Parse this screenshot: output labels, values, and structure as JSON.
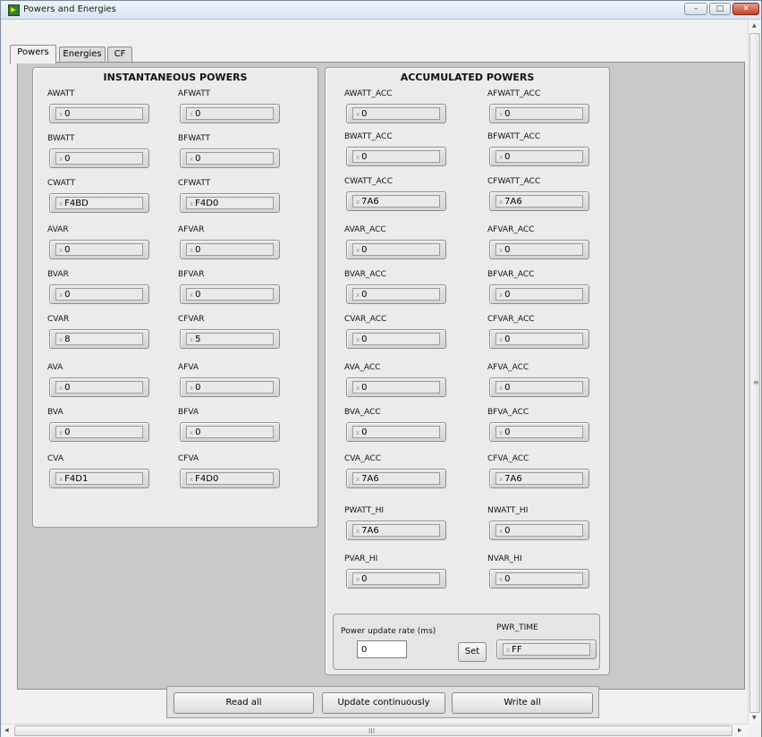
{
  "window": {
    "title": "Powers and Energies",
    "minimize": "–",
    "maximize": "□",
    "close": "✕"
  },
  "tabs": [
    {
      "label": "Powers",
      "active": true
    },
    {
      "label": "Energies",
      "active": false
    },
    {
      "label": "CF",
      "active": false
    }
  ],
  "inst": {
    "title": "INSTANTANEOUS POWERS",
    "fields": [
      {
        "label": "AWATT",
        "value": "0"
      },
      {
        "label": "AFWATT",
        "value": "0"
      },
      {
        "label": "BWATT",
        "value": "0"
      },
      {
        "label": "BFWATT",
        "value": "0"
      },
      {
        "label": "CWATT",
        "value": "F4BD"
      },
      {
        "label": "CFWATT",
        "value": "F4D0"
      },
      {
        "label": "AVAR",
        "value": "0"
      },
      {
        "label": "AFVAR",
        "value": "0"
      },
      {
        "label": "BVAR",
        "value": "0"
      },
      {
        "label": "BFVAR",
        "value": "0"
      },
      {
        "label": "CVAR",
        "value": "8"
      },
      {
        "label": "CFVAR",
        "value": "5"
      },
      {
        "label": "AVA",
        "value": "0"
      },
      {
        "label": "AFVA",
        "value": "0"
      },
      {
        "label": "BVA",
        "value": "0"
      },
      {
        "label": "BFVA",
        "value": "0"
      },
      {
        "label": "CVA",
        "value": "F4D1"
      },
      {
        "label": "CFVA",
        "value": "F4D0"
      }
    ]
  },
  "acc": {
    "title": "ACCUMULATED POWERS",
    "fields": [
      {
        "label": "AWATT_ACC",
        "value": "0"
      },
      {
        "label": "AFWATT_ACC",
        "value": "0"
      },
      {
        "label": "BWATT_ACC",
        "value": "0"
      },
      {
        "label": "BFWATT_ACC",
        "value": "0"
      },
      {
        "label": "CWATT_ACC",
        "value": "7A6"
      },
      {
        "label": "CFWATT_ACC",
        "value": "7A6"
      },
      {
        "label": "AVAR_ACC",
        "value": "0"
      },
      {
        "label": "AFVAR_ACC",
        "value": "0"
      },
      {
        "label": "BVAR_ACC",
        "value": "0"
      },
      {
        "label": "BFVAR_ACC",
        "value": "0"
      },
      {
        "label": "CVAR_ACC",
        "value": "0"
      },
      {
        "label": "CFVAR_ACC",
        "value": "0"
      },
      {
        "label": "AVA_ACC",
        "value": "0"
      },
      {
        "label": "AFVA_ACC",
        "value": "0"
      },
      {
        "label": "BVA_ACC",
        "value": "0"
      },
      {
        "label": "BFVA_ACC",
        "value": "0"
      },
      {
        "label": "CVA_ACC",
        "value": "7A6"
      },
      {
        "label": "CFVA_ACC",
        "value": "7A6"
      },
      {
        "label": "PWATT_HI",
        "value": "7A6"
      },
      {
        "label": "NWATT_HI",
        "value": "0"
      },
      {
        "label": "PVAR_HI",
        "value": "0"
      },
      {
        "label": "NVAR_HI",
        "value": "0"
      }
    ]
  },
  "rate": {
    "label": "Power update rate (ms)",
    "value": "0",
    "set_label": "Set",
    "pwr_time_label": "PWR_TIME",
    "pwr_time_value": "FF"
  },
  "hex_marker": "x",
  "buttons": {
    "read_all": "Read all",
    "update_continuously": "Update continuously",
    "write_all": "Write all"
  },
  "scrollbars": {
    "grip_vertical": "≡",
    "grip_horizontal": "III",
    "arrow_up": "▲",
    "arrow_down": "▼",
    "arrow_left": "◀",
    "arrow_right": "▶"
  },
  "colors": {
    "panel_bg": "#c9c9c9",
    "group_bg": "#ebebeb",
    "field_bg": "#e9e9e9"
  }
}
